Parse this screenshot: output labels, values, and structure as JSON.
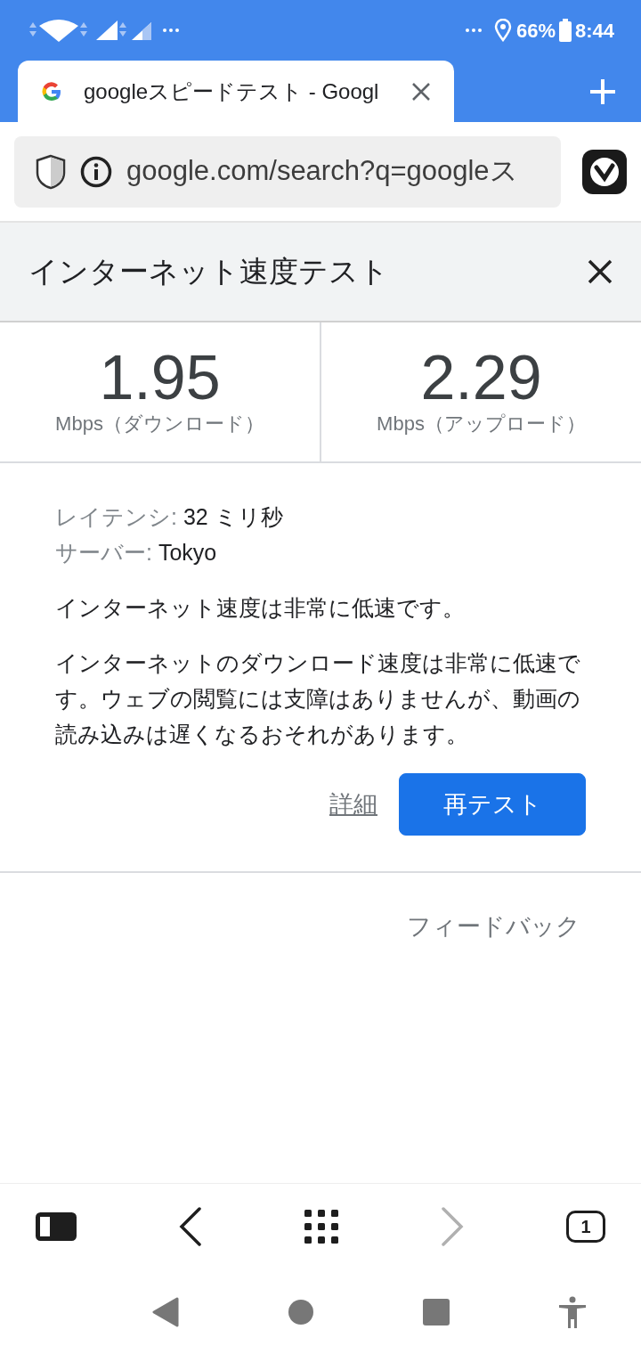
{
  "status_bar": {
    "battery": "66%",
    "time": "8:44"
  },
  "tab": {
    "title": "googleスピードテスト - Googl"
  },
  "address_bar": {
    "url": "google.com/search?q=googleス"
  },
  "speed_test": {
    "title": "インターネット速度テスト",
    "results": [
      {
        "value": "1.95",
        "label": "Mbps（ダウンロード）"
      },
      {
        "value": "2.29",
        "label": "Mbps（アップロード）"
      }
    ],
    "details": [
      {
        "label": "レイテンシ:",
        "value": "32 ミリ秒"
      },
      {
        "label": "サーバー:",
        "value": "Tokyo"
      }
    ],
    "summary": "インターネット速度は非常に低速です。",
    "description": "インターネットのダウンロード速度は非常に低速です。ウェブの閲覧には支障はありませんが、動画の読み込みは遅くなるおそれがあります。",
    "details_link": "詳細",
    "retest_button": "再テスト",
    "feedback": "フィードバック"
  },
  "toolbar": {
    "back_disabled": false,
    "forward_disabled": true,
    "tab_count": "1"
  }
}
